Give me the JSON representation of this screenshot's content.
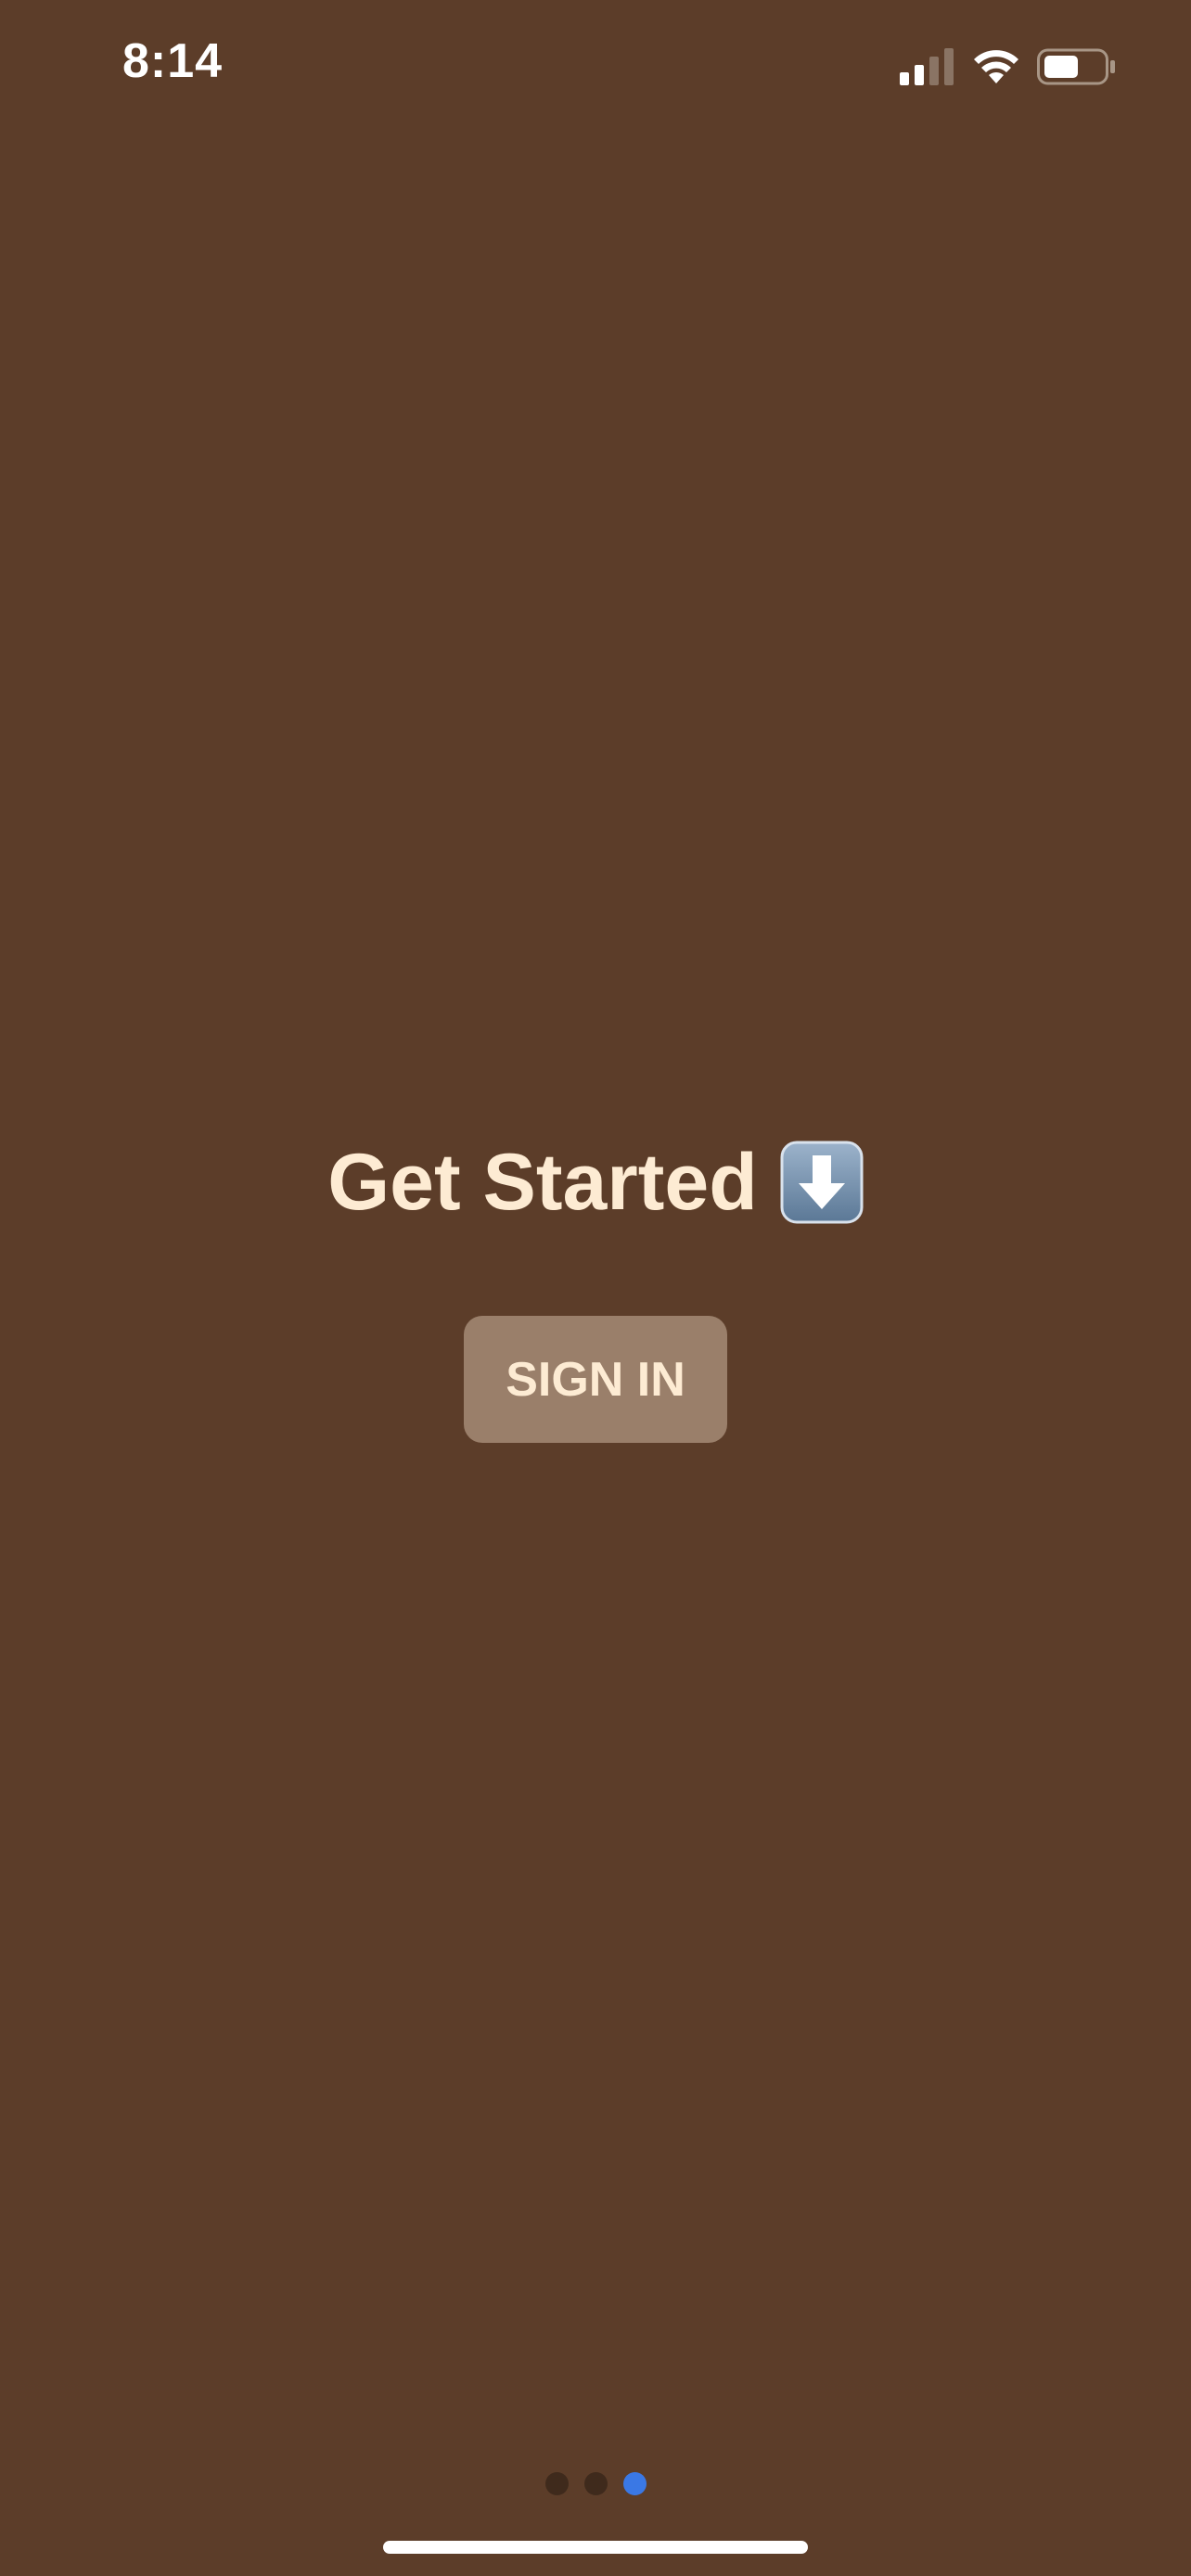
{
  "status_bar": {
    "time": "8:14",
    "signal_icon": "cellular-signal-icon",
    "wifi_icon": "wifi-icon",
    "battery_icon": "battery-icon"
  },
  "main": {
    "headline": "Get Started",
    "headline_emoji": "down-arrow-emoji-icon",
    "signin_label": "SIGN IN"
  },
  "pager": {
    "total_pages": 3,
    "current_page": 3
  },
  "colors": {
    "background": "#5c3d29",
    "headline_text": "#fdebd3",
    "button_bg": "#9a7f6a",
    "active_dot": "#3a78e5",
    "inactive_dot": "#3f2a1c"
  }
}
